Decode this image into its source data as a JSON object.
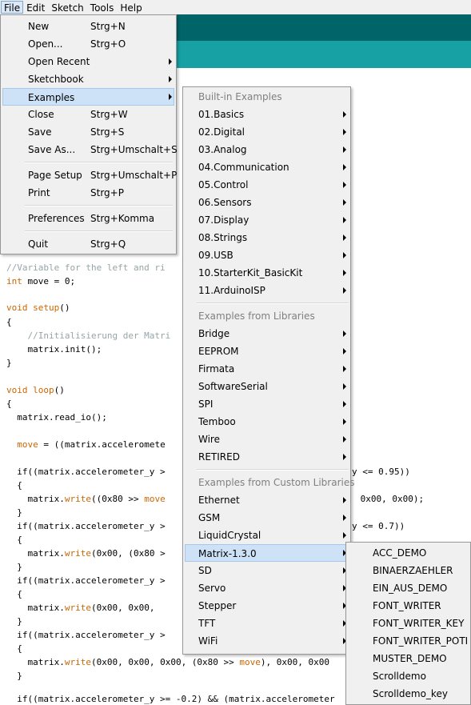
{
  "menubar": [
    "File",
    "Edit",
    "Sketch",
    "Tools",
    "Help"
  ],
  "file_menu": {
    "items": [
      {
        "label": "New",
        "shortcut": "Strg+N"
      },
      {
        "label": "Open...",
        "shortcut": "Strg+O"
      },
      {
        "label": "Open Recent",
        "shortcut": ""
      },
      {
        "label": "Sketchbook",
        "shortcut": ""
      },
      {
        "label": "Examples",
        "shortcut": ""
      },
      {
        "label": "Close",
        "shortcut": "Strg+W"
      },
      {
        "label": "Save",
        "shortcut": "Strg+S"
      },
      {
        "label": "Save As...",
        "shortcut": "Strg+Umschalt+S"
      },
      {
        "label": "Page Setup",
        "shortcut": "Strg+Umschalt+P"
      },
      {
        "label": "Print",
        "shortcut": "Strg+P"
      },
      {
        "label": "Preferences",
        "shortcut": "Strg+Komma"
      },
      {
        "label": "Quit",
        "shortcut": "Strg+Q"
      }
    ]
  },
  "examples_menu": {
    "headers": [
      "Built-in Examples",
      "Examples from Libraries",
      "Examples from Custom Libraries"
    ],
    "builtin": [
      "01.Basics",
      "02.Digital",
      "03.Analog",
      "04.Communication",
      "05.Control",
      "06.Sensors",
      "07.Display",
      "08.Strings",
      "09.USB",
      "10.StarterKit_BasicKit",
      "11.ArduinoISP"
    ],
    "libraries": [
      "Bridge",
      "EEPROM",
      "Firmata",
      "SoftwareSerial",
      "SPI",
      "Temboo",
      "Wire",
      "RETIRED"
    ],
    "custom": [
      "Ethernet",
      "GSM",
      "LiquidCrystal",
      "Matrix-1.3.0",
      "SD",
      "Servo",
      "Stepper",
      "TFT",
      "WiFi"
    ]
  },
  "matrix_menu": {
    "items": [
      "ACC_DEMO",
      "BINAERZAEHLER",
      "EIN_AUS_DEMO",
      "FONT_WRITER",
      "FONT_WRITER_KEY",
      "FONT_WRITER_POTI",
      "MUSTER_DEMO",
      "Scrolldemo",
      "Scrolldemo_key"
    ]
  },
  "code": {
    "l1": "//Variable for the left and ri",
    "l2_kw": "int",
    "l2_rest": " move = 0;",
    "l3_kw": "void",
    "l3_fn": "setup",
    "l3_rest": "()",
    "l4": "{",
    "l5": "    //Initialisierung der Matri",
    "l6": "    matrix.init();",
    "l7": "}",
    "l8_kw": "void",
    "l8_fn": "loop",
    "l8_rest": "()",
    "l9": "{",
    "l10": "  matrix.read_io();",
    "l11_a": "  ",
    "l11_b": "move",
    "l11_c": " = ((matrix.acceleromete",
    "l12": "  if((matrix.accelerometer_y >",
    "l12r": "y <= 0.95))",
    "l13": "  {",
    "l14_a": "    matrix.",
    "l14_b": "write",
    "l14_c": "((0x80 >> ",
    "l14_d": "move",
    "l14r": " 0x00, 0x00);",
    "l15": "  }",
    "l16": "  if((matrix.accelerometer_y >",
    "l16r": "y <= 0.7))",
    "l17": "  {",
    "l18_a": "    matrix.",
    "l18_b": "write",
    "l18_c": "(0x00, (0x80 >",
    "l19": "  }",
    "l20": "  if((matrix.accelerometer_y >",
    "l21": "  {",
    "l22_a": "    matrix.",
    "l22_b": "write",
    "l22_c": "(0x00, 0x00,",
    "l23": "  }",
    "l24": "  if((matrix.accelerometer_y >",
    "l25": "  {",
    "l26_a": "    matrix.",
    "l26_b": "write",
    "l26_c": "(0x00, 0x00, 0x00, (0x80 >> ",
    "l26_d": "move",
    "l26_e": "), 0x00, 0x00",
    "l27": "  }",
    "l28": "  if((matrix.accelerometer_y >= -0.2) && (matrix.accelerometer"
  }
}
